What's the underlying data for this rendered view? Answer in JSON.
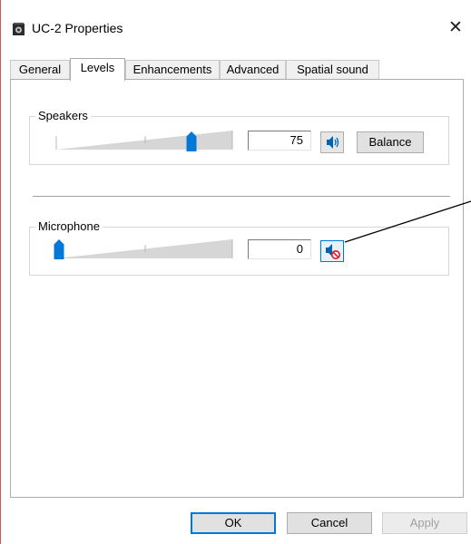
{
  "window": {
    "title": "UC-2 Properties",
    "close_glyph": "✕"
  },
  "tabs": [
    {
      "label": "General",
      "active": false
    },
    {
      "label": "Levels",
      "active": true
    },
    {
      "label": "Enhancements",
      "active": false
    },
    {
      "label": "Advanced",
      "active": false
    },
    {
      "label": "Spatial sound",
      "active": false
    }
  ],
  "speakers": {
    "label": "Speakers",
    "value": "75",
    "level_percent": 75,
    "mute_icon": "speaker-icon",
    "balance_label": "Balance"
  },
  "microphone": {
    "label": "Microphone",
    "value": "0",
    "level_percent": 0,
    "mute_icon": "speaker-muted-icon"
  },
  "buttons": {
    "ok": "OK",
    "cancel": "Cancel",
    "apply": "Apply"
  },
  "colors": {
    "accent": "#0078d7",
    "mute_red": "#e81123",
    "annotation": "#000000"
  }
}
